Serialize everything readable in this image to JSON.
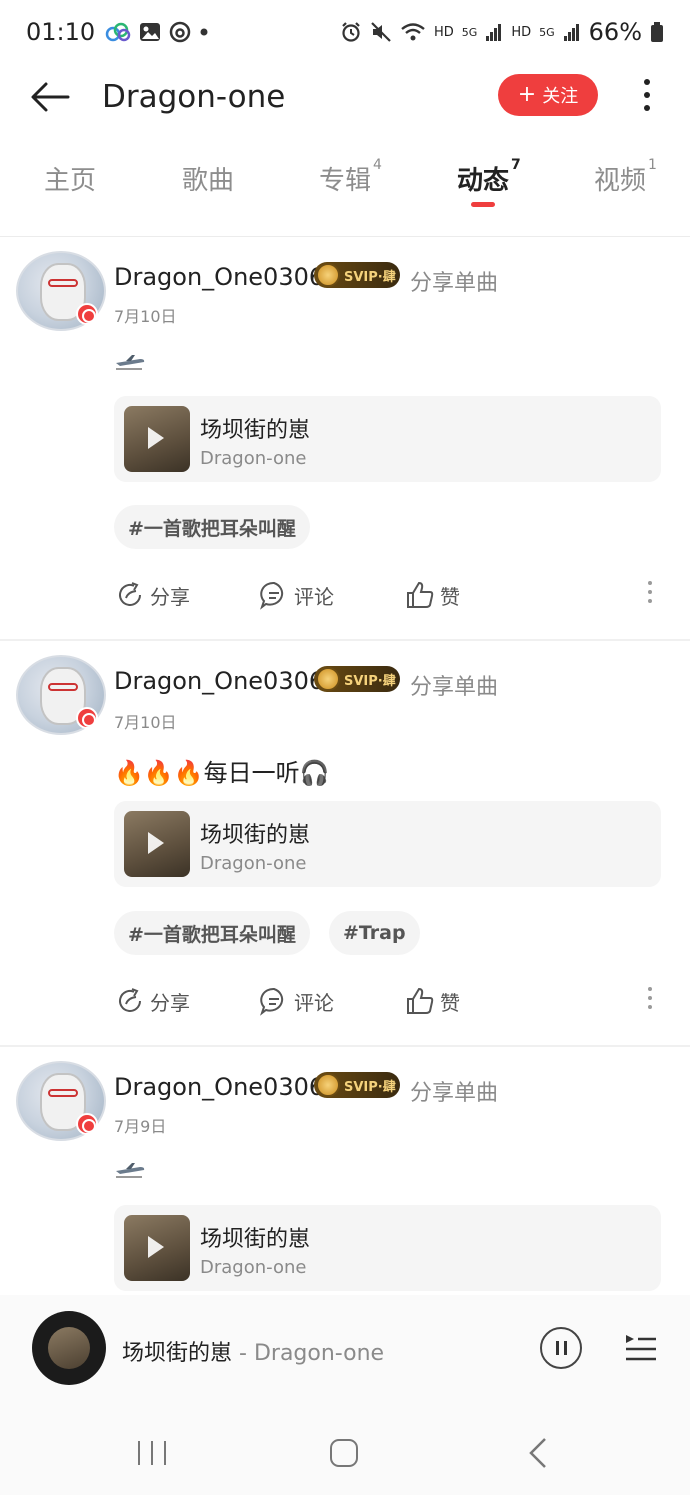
{
  "status_bar": {
    "time": "01:10",
    "battery": "66%",
    "hd1": "HD",
    "hd2": "HD",
    "net1": "5G",
    "net2": "5G"
  },
  "header": {
    "title": "Dragon-one",
    "follow_label": "关注",
    "follow_plus": "+"
  },
  "tabs": [
    {
      "label": "主页",
      "count": ""
    },
    {
      "label": "歌曲",
      "count": ""
    },
    {
      "label": "专辑",
      "count": "4"
    },
    {
      "label": "动态",
      "count": "7"
    },
    {
      "label": "视频",
      "count": "1"
    }
  ],
  "posts": [
    {
      "username": "Dragon_One0306",
      "vip": "SVIP·肆",
      "action": "分享单曲",
      "date": "7月10日",
      "text": "",
      "song_title": "场坝街的崽",
      "song_artist": "Dragon-one",
      "tags": [
        "#一首歌把耳朵叫醒"
      ]
    },
    {
      "username": "Dragon_One0306",
      "vip": "SVIP·肆",
      "action": "分享单曲",
      "date": "7月10日",
      "text": "🔥🔥🔥每日一听🎧",
      "song_title": "场坝街的崽",
      "song_artist": "Dragon-one",
      "tags": [
        "#一首歌把耳朵叫醒",
        "#Trap"
      ]
    },
    {
      "username": "Dragon_One0306",
      "vip": "SVIP·肆",
      "action": "分享单曲",
      "date": "7月9日",
      "text": "",
      "song_title": "场坝街的崽",
      "song_artist": "Dragon-one",
      "tags": []
    }
  ],
  "post_actions": {
    "share": "分享",
    "comment": "评论",
    "like": "赞"
  },
  "player": {
    "song": "场坝街的崽",
    "separator": " - ",
    "artist": "Dragon-one"
  },
  "icons": {
    "back": "back-arrow-icon",
    "more": "more-vertical-icon",
    "pause": "pause-icon",
    "playlist": "playlist-icon"
  }
}
